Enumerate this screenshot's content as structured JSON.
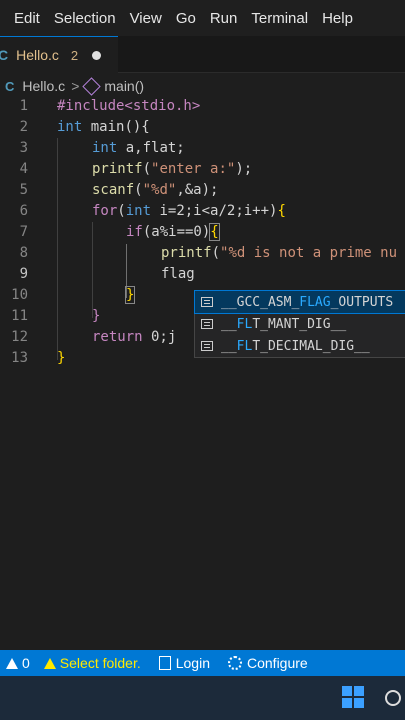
{
  "menu": [
    "Edit",
    "Selection",
    "View",
    "Go",
    "Run",
    "Terminal",
    "Help"
  ],
  "tab": {
    "icon": "C",
    "label": "Hello.c",
    "badge": "2"
  },
  "breadcrumb": {
    "file": "Hello.c",
    "separator": ">",
    "symbol": "main()"
  },
  "line_numbers": [
    "1",
    "2",
    "3",
    "4",
    "5",
    "6",
    "7",
    "8",
    "9",
    "10",
    "11",
    "12",
    "13"
  ],
  "code": {
    "l1": "#include<stdio.h>",
    "l2a": "int",
    "l2b": " main(){",
    "l3a": "int",
    "l3b": " a,flat;",
    "l4a": "printf",
    "l4b": "(",
    "l4c": "\"enter a:\"",
    "l4d": ");",
    "l5a": "scanf",
    "l5b": "(",
    "l5c": "\"%d\"",
    "l5d": ",&a);",
    "l6a": "for",
    "l6b": "(",
    "l6c": "int",
    "l6d": " i=2;i<a/2;i++)",
    "l6e": "{",
    "l7a": "if",
    "l7b": "(a%i==0)",
    "l7c": "{",
    "l8a": "printf",
    "l8b": "(",
    "l8c": "\"%d is not a prime nu",
    "l9": "flag",
    "l10": "}",
    "l11": "}",
    "l12a": "return",
    "l12b": " 0;j",
    "l13": "}"
  },
  "suggestions": [
    {
      "pre": "__GCC_ASM_",
      "match": "FLAG",
      "post": "_OUTPUTS"
    },
    {
      "pre": "__",
      "match": "FL",
      "post": "T_MANT_DIG__"
    },
    {
      "pre": "__",
      "match": "FL",
      "post": "T_DECIMAL_DIG__"
    }
  ],
  "status": {
    "problems": "0",
    "warning": "Select folder.",
    "login": "Login",
    "configure": "Configure"
  },
  "colors": {
    "accent": "#0078d4",
    "tab_modified": "#e2c08d",
    "keyword": "#569cd6",
    "string": "#ce9178",
    "function": "#dcdcaa"
  }
}
